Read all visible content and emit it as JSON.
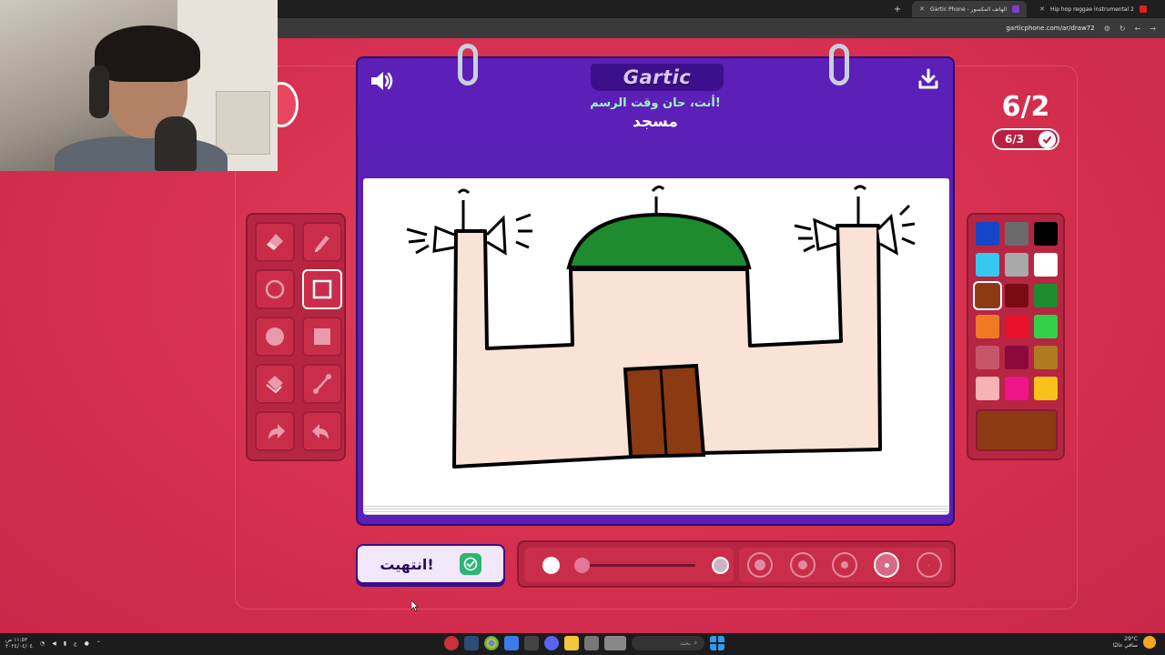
{
  "browser": {
    "tabs": [
      {
        "title": "Gartic Phone - الهاتف المكسور",
        "active": true,
        "fav_color": "#7b3fd3"
      },
      {
        "title": "Hip hop reggae instrumental 2",
        "active": false,
        "fav_color": "#e02020"
      }
    ],
    "new_tab_label": "+",
    "url": "garticphone.com/ar/draw72"
  },
  "game": {
    "logo": "Gartic",
    "prompt_subtitle": "أنت، حان وقت الرسم!",
    "prompt_word": "مسجد",
    "round_main": "6/2",
    "round_done": "6/3",
    "done_button_label": "انتهيت!",
    "opacity_level": 0.1,
    "selected_tool": "rectangle",
    "selected_size_index": 3,
    "current_color": "#8b3a12"
  },
  "tools": [
    {
      "name": "eraser-icon"
    },
    {
      "name": "pencil-icon"
    },
    {
      "name": "circle-outline-icon"
    },
    {
      "name": "rectangle-outline-icon"
    },
    {
      "name": "circle-filled-icon"
    },
    {
      "name": "rectangle-filled-icon"
    },
    {
      "name": "fill-bucket-icon"
    },
    {
      "name": "line-icon"
    },
    {
      "name": "redo-icon"
    },
    {
      "name": "undo-icon"
    }
  ],
  "palette": [
    "#1546c8",
    "#6b6b6b",
    "#000000",
    "#37c8f2",
    "#a9a9a9",
    "#ffffff",
    "#8b3a12",
    "#7a0a14",
    "#1e8c2e",
    "#f07a24",
    "#e8102a",
    "#33d04a",
    "#c8566a",
    "#8a0a3c",
    "#b07a22",
    "#f8b2b6",
    "#f0148a",
    "#f8c21a"
  ],
  "taskbar": {
    "time": "١١:٥٣ ص",
    "date": "٢٠٢٤/٠٤/٠٤",
    "lang": "ع",
    "search_placeholder": "بحث",
    "weather_temp": "29°C",
    "weather_desc": "صافي غالبًا"
  }
}
